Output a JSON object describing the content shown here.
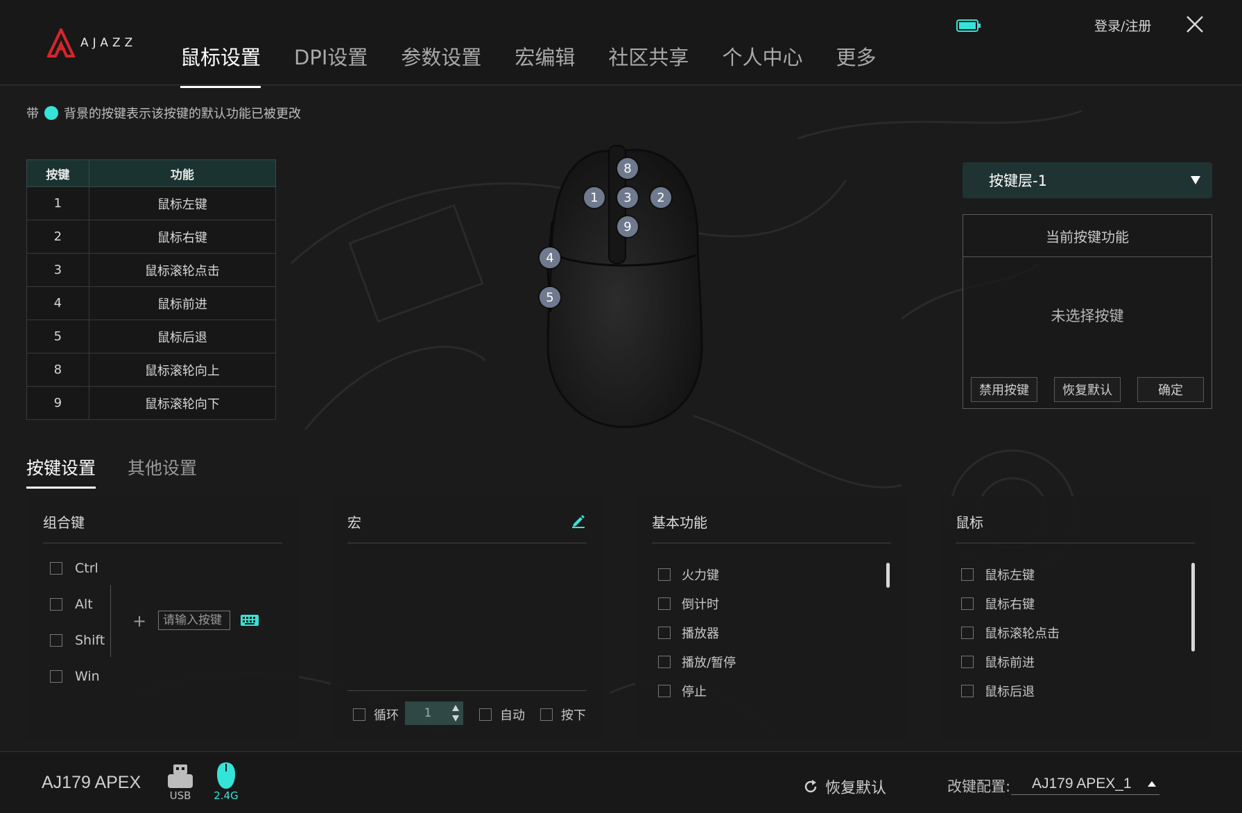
{
  "brand": {
    "logo_text": "AJAZZ"
  },
  "header": {
    "tabs": [
      {
        "label": "鼠标设置",
        "active": true
      },
      {
        "label": "DPI设置"
      },
      {
        "label": "参数设置"
      },
      {
        "label": "宏编辑"
      },
      {
        "label": "社区共享"
      },
      {
        "label": "个人中心"
      },
      {
        "label": "更多"
      }
    ],
    "login_label": "登录/注册",
    "battery_icon": "battery-icon",
    "close_icon": "close-icon"
  },
  "hint": {
    "prefix": "带",
    "suffix": "背景的按键表示该按键的默认功能已被更改",
    "dot_color": "#34e4d8"
  },
  "button_table": {
    "headers": [
      "按键",
      "功能"
    ],
    "rows": [
      {
        "key": "1",
        "func": "鼠标左键"
      },
      {
        "key": "2",
        "func": "鼠标右键"
      },
      {
        "key": "3",
        "func": "鼠标滚轮点击"
      },
      {
        "key": "4",
        "func": "鼠标前进"
      },
      {
        "key": "5",
        "func": "鼠标后退"
      },
      {
        "key": "8",
        "func": "鼠标滚轮向上"
      },
      {
        "key": "9",
        "func": "鼠标滚轮向下"
      }
    ]
  },
  "mouse": {
    "badges": [
      "8",
      "1",
      "3",
      "2",
      "9",
      "4",
      "5"
    ]
  },
  "right_panel": {
    "layer_label": "按键层-1",
    "title": "当前按键功能",
    "empty_text": "未选择按键",
    "buttons": [
      "禁用按键",
      "恢复默认",
      "确定"
    ]
  },
  "subtabs": [
    {
      "label": "按键设置",
      "active": true
    },
    {
      "label": "其他设置"
    }
  ],
  "combo_panel": {
    "title": "组合键",
    "modifiers": [
      "Ctrl",
      "Alt",
      "Shift",
      "Win"
    ],
    "plus": "+",
    "input_placeholder": "请输入按键",
    "keyboard_icon": "keyboard-icon"
  },
  "macro_panel": {
    "title": "宏",
    "edit_icon": "pencil-icon",
    "loop_label": "循环",
    "loop_value": "1",
    "auto_label": "自动",
    "press_label": "按下"
  },
  "basic_panel": {
    "title": "基本功能",
    "items": [
      "火力键",
      "倒计时",
      "播放器",
      "播放/暂停",
      "停止"
    ]
  },
  "mouse_panel": {
    "title": "鼠标",
    "items": [
      "鼠标左键",
      "鼠标右键",
      "鼠标滚轮点击",
      "鼠标前进",
      "鼠标后退"
    ]
  },
  "footer": {
    "model": "AJ179 APEX",
    "connections": [
      {
        "label": "USB",
        "icon": "usb-icon",
        "active": false
      },
      {
        "label": "2.4G",
        "icon": "mouse-icon",
        "active": true
      }
    ],
    "reset_label": "恢复默认",
    "profile_label": "改键配置:",
    "profile_value": "AJ179 APEX_1"
  },
  "colors": {
    "accent": "#34e4d8",
    "header_active": "#1f3432"
  }
}
